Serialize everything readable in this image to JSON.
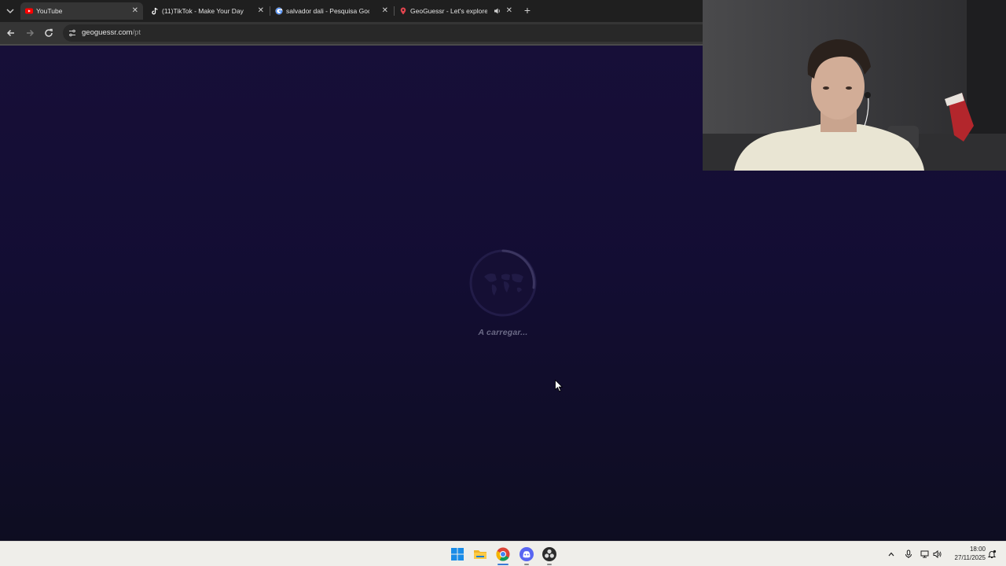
{
  "browser": {
    "tab_list_icon": "chevron-down-icon",
    "tabs": [
      {
        "label": "YouTube",
        "icon": "youtube-icon",
        "active": true
      },
      {
        "label": "(11)TikTok - Make Your Day",
        "icon": "tiktok-icon",
        "active": false
      },
      {
        "label": "salvador dali - Pesquisa Google",
        "icon": "google-icon",
        "active": false
      },
      {
        "label": "GeoGuessr - Let's explore t",
        "icon": "geoguessr-icon",
        "active": false,
        "audio": true
      }
    ],
    "close_glyph": "✕",
    "new_tab_glyph": "+",
    "url_host": "geoguessr.com",
    "url_path": "/pt"
  },
  "page": {
    "loading_text": "A carregar...",
    "colors": {
      "top": "#170f38",
      "bottom": "#0e0d21",
      "loading_text": "#6b6a86"
    }
  },
  "taskbar": {
    "apps": [
      "windows-start-icon",
      "file-explorer-icon",
      "chrome-icon",
      "discord-icon",
      "obs-icon"
    ],
    "tray": [
      "chevron-up-icon",
      "microphone-icon",
      "network-icon",
      "volume-icon"
    ],
    "time": "18:00",
    "date": "27/11/2025",
    "notification_icon": "notification-bell-icon"
  }
}
